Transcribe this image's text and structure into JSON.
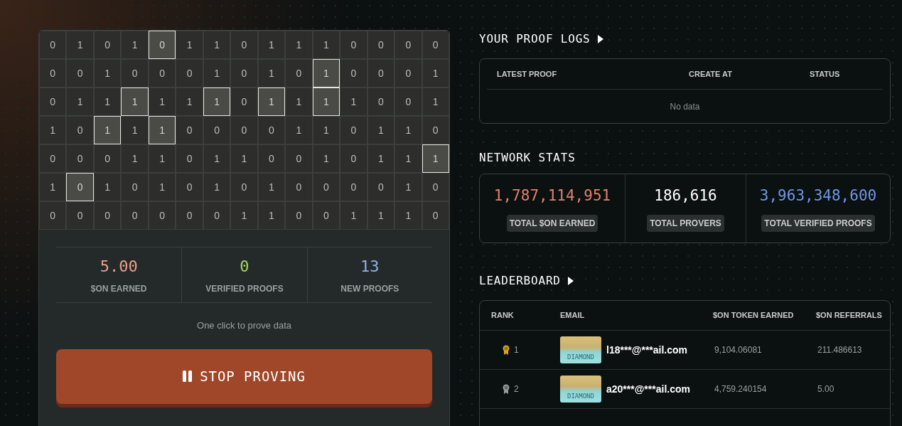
{
  "grid": [
    [
      {
        "v": "0",
        "selected": false
      },
      {
        "v": "1",
        "selected": false
      },
      {
        "v": "0",
        "selected": false
      },
      {
        "v": "1",
        "selected": false
      },
      {
        "v": "0",
        "selected": true
      },
      {
        "v": "1",
        "selected": false
      },
      {
        "v": "1",
        "selected": false
      },
      {
        "v": "0",
        "selected": false
      },
      {
        "v": "1",
        "selected": false
      },
      {
        "v": "1",
        "selected": false
      },
      {
        "v": "1",
        "selected": false
      },
      {
        "v": "0",
        "selected": false
      },
      {
        "v": "0",
        "selected": false
      },
      {
        "v": "0",
        "selected": false
      },
      {
        "v": "0",
        "selected": false
      }
    ],
    [
      {
        "v": "0",
        "selected": false
      },
      {
        "v": "0",
        "selected": false
      },
      {
        "v": "1",
        "selected": false
      },
      {
        "v": "0",
        "selected": false
      },
      {
        "v": "0",
        "selected": false
      },
      {
        "v": "0",
        "selected": false
      },
      {
        "v": "1",
        "selected": false
      },
      {
        "v": "0",
        "selected": false
      },
      {
        "v": "1",
        "selected": false
      },
      {
        "v": "0",
        "selected": false
      },
      {
        "v": "1",
        "selected": true
      },
      {
        "v": "0",
        "selected": false
      },
      {
        "v": "0",
        "selected": false
      },
      {
        "v": "0",
        "selected": false
      },
      {
        "v": "1",
        "selected": false
      }
    ],
    [
      {
        "v": "0",
        "selected": false
      },
      {
        "v": "1",
        "selected": false
      },
      {
        "v": "1",
        "selected": false
      },
      {
        "v": "1",
        "selected": true
      },
      {
        "v": "1",
        "selected": false
      },
      {
        "v": "1",
        "selected": false
      },
      {
        "v": "1",
        "selected": true
      },
      {
        "v": "0",
        "selected": false
      },
      {
        "v": "1",
        "selected": true
      },
      {
        "v": "1",
        "selected": false
      },
      {
        "v": "1",
        "selected": true
      },
      {
        "v": "1",
        "selected": false
      },
      {
        "v": "0",
        "selected": false
      },
      {
        "v": "0",
        "selected": false
      },
      {
        "v": "1",
        "selected": false
      }
    ],
    [
      {
        "v": "1",
        "selected": false
      },
      {
        "v": "0",
        "selected": false
      },
      {
        "v": "1",
        "selected": true
      },
      {
        "v": "1",
        "selected": false
      },
      {
        "v": "1",
        "selected": true
      },
      {
        "v": "0",
        "selected": false
      },
      {
        "v": "0",
        "selected": false
      },
      {
        "v": "0",
        "selected": false
      },
      {
        "v": "0",
        "selected": false
      },
      {
        "v": "1",
        "selected": false
      },
      {
        "v": "1",
        "selected": false
      },
      {
        "v": "0",
        "selected": false
      },
      {
        "v": "1",
        "selected": false
      },
      {
        "v": "1",
        "selected": false
      },
      {
        "v": "0",
        "selected": false
      }
    ],
    [
      {
        "v": "0",
        "selected": false
      },
      {
        "v": "0",
        "selected": false
      },
      {
        "v": "0",
        "selected": false
      },
      {
        "v": "1",
        "selected": false
      },
      {
        "v": "1",
        "selected": false
      },
      {
        "v": "0",
        "selected": false
      },
      {
        "v": "1",
        "selected": false
      },
      {
        "v": "1",
        "selected": false
      },
      {
        "v": "0",
        "selected": false
      },
      {
        "v": "0",
        "selected": false
      },
      {
        "v": "1",
        "selected": false
      },
      {
        "v": "0",
        "selected": false
      },
      {
        "v": "1",
        "selected": false
      },
      {
        "v": "1",
        "selected": false
      },
      {
        "v": "1",
        "selected": true
      }
    ],
    [
      {
        "v": "1",
        "selected": false
      },
      {
        "v": "0",
        "selected": true
      },
      {
        "v": "1",
        "selected": false
      },
      {
        "v": "0",
        "selected": false
      },
      {
        "v": "1",
        "selected": false
      },
      {
        "v": "0",
        "selected": false
      },
      {
        "v": "1",
        "selected": false
      },
      {
        "v": "0",
        "selected": false
      },
      {
        "v": "1",
        "selected": false
      },
      {
        "v": "0",
        "selected": false
      },
      {
        "v": "0",
        "selected": false
      },
      {
        "v": "0",
        "selected": false
      },
      {
        "v": "0",
        "selected": false
      },
      {
        "v": "1",
        "selected": false
      },
      {
        "v": "0",
        "selected": false
      }
    ],
    [
      {
        "v": "0",
        "selected": false
      },
      {
        "v": "0",
        "selected": false
      },
      {
        "v": "0",
        "selected": false
      },
      {
        "v": "0",
        "selected": false
      },
      {
        "v": "0",
        "selected": false
      },
      {
        "v": "0",
        "selected": false
      },
      {
        "v": "0",
        "selected": false
      },
      {
        "v": "1",
        "selected": false
      },
      {
        "v": "1",
        "selected": false
      },
      {
        "v": "0",
        "selected": false
      },
      {
        "v": "0",
        "selected": false
      },
      {
        "v": "1",
        "selected": false
      },
      {
        "v": "1",
        "selected": false
      },
      {
        "v": "1",
        "selected": false
      },
      {
        "v": "0",
        "selected": false
      }
    ]
  ],
  "my_stats": [
    {
      "value": "5.00",
      "label": "$ON EARNED",
      "color": "#e8a08a"
    },
    {
      "value": "0",
      "label": "VERIFIED PROOFS",
      "color": "#a6d65a"
    },
    {
      "value": "13",
      "label": "NEW PROOFS",
      "color": "#8fb0ea"
    }
  ],
  "hint": "One click to prove data",
  "button": {
    "label": "STOP PROVING"
  },
  "proof_logs": {
    "title": "YOUR PROOF LOGS",
    "columns": [
      "LATEST PROOF",
      "CREATE AT",
      "STATUS"
    ],
    "empty": "No data"
  },
  "network_stats": {
    "title": "NETWORK STATS",
    "items": [
      {
        "value": "1,787,114,951",
        "label": "TOTAL $ON EARNED",
        "color": "#e2806a"
      },
      {
        "value": "186,616",
        "label": "TOTAL PROVERS",
        "color": "#ffffff"
      },
      {
        "value": "3,963,348,600",
        "label": "TOTAL VERIFIED PROOFS",
        "color": "#6f98e8"
      }
    ]
  },
  "leaderboard": {
    "title": "LEADERBOARD",
    "columns": [
      "RANK",
      "EMAIL",
      "$ON TOKEN EARNED",
      "$ON REFERRALS"
    ],
    "rows": [
      {
        "rank": "1",
        "color": "#d9a520",
        "badge": "DIAMOND",
        "email": "l18***@***ail.com",
        "earned": "9,104.06081",
        "referrals": "211.486613"
      },
      {
        "rank": "2",
        "color": "#9a9a9a",
        "badge": "DIAMOND",
        "email": "a20***@***ail.com",
        "earned": "4,759.240154",
        "referrals": "5.00"
      }
    ]
  }
}
